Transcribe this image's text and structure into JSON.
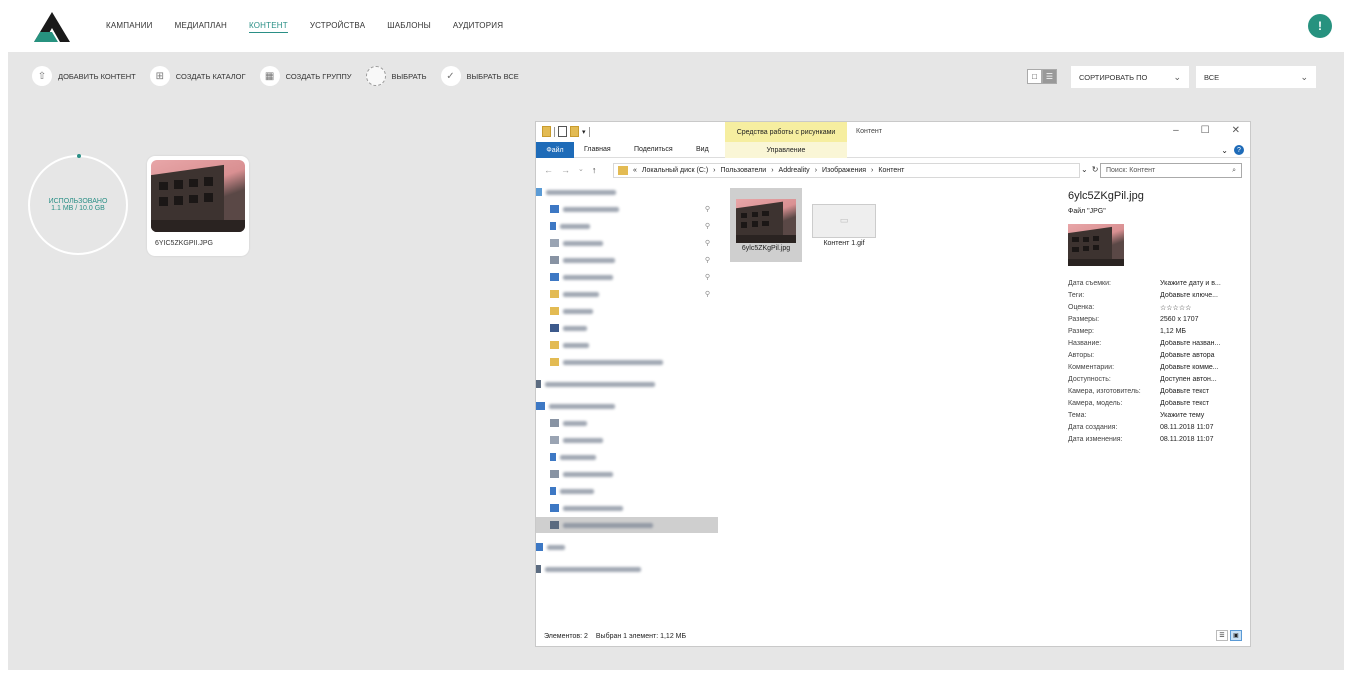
{
  "nav": {
    "items": [
      {
        "label": "КАМПАНИИ",
        "active": false
      },
      {
        "label": "МЕДИАПЛАН",
        "active": false
      },
      {
        "label": "КОНТЕНТ",
        "active": true
      },
      {
        "label": "УСТРОЙСТВА",
        "active": false
      },
      {
        "label": "ШАБЛОНЫ",
        "active": false
      },
      {
        "label": "АУДИТОРИЯ",
        "active": false
      }
    ]
  },
  "user": {
    "badge": "!"
  },
  "toolbar": {
    "add_content": "ДОБАВИТЬ КОНТЕНТ",
    "create_folder": "СОЗДАТЬ КАТАЛОГ",
    "create_group": "СОЗДАТЬ ГРУППУ",
    "select": "ВЫБРАТЬ",
    "select_all": "ВЫБРАТЬ ВСЕ",
    "sort_label": "СОРТИРОВАТЬ ПО",
    "filter_label": "ВСЕ"
  },
  "usage": {
    "label": "ИСПОЛЬЗОВАНО",
    "value": "1.1 MB / 10.0 GB"
  },
  "card": {
    "filename": "6YIC5ZKGPII.JPG"
  },
  "explorer": {
    "tools_tab": "Средства работы с рисунками",
    "window_title": "Контент",
    "ribbon": {
      "file": "Файл",
      "home": "Главная",
      "share": "Поделиться",
      "view": "Вид",
      "manage": "Управление"
    },
    "address": {
      "prefix": "«",
      "parts": [
        "Локальный диск (C:)",
        "Пользователи",
        "Addreality",
        "Изображения",
        "Контент"
      ],
      "separator": "›"
    },
    "search_placeholder": "Поиск: Контент",
    "files": [
      {
        "name": "6ylc5ZKgPil.jpg",
        "selected": true
      },
      {
        "name": "Контент 1.gif",
        "selected": false
      }
    ],
    "details": {
      "name": "6ylc5ZKgPil.jpg",
      "type": "Файл \"JPG\"",
      "props": [
        {
          "k": "Дата съемки:",
          "v": "Укажите дату и в..."
        },
        {
          "k": "Теги:",
          "v": "Добавьте ключе..."
        },
        {
          "k": "Оценка:",
          "v": "☆☆☆☆☆"
        },
        {
          "k": "Размеры:",
          "v": "2560 x 1707"
        },
        {
          "k": "Размер:",
          "v": "1,12 МБ"
        },
        {
          "k": "Название:",
          "v": "Добавьте назван..."
        },
        {
          "k": "Авторы:",
          "v": "Добавьте автора"
        },
        {
          "k": "Комментарии:",
          "v": "Добавьте комме..."
        },
        {
          "k": "Доступность:",
          "v": "Доступен автон..."
        },
        {
          "k": "Камера, изготовитель:",
          "v": "Добавьте текст"
        },
        {
          "k": "Камера, модель:",
          "v": "Добавьте текст"
        },
        {
          "k": "Тема:",
          "v": "Укажите тему"
        },
        {
          "k": "Дата создания:",
          "v": "08.11.2018 11:07"
        },
        {
          "k": "Дата изменения:",
          "v": "08.11.2018 11:07"
        }
      ]
    },
    "status": {
      "items_count": "Элементов: 2",
      "selected": "Выбран 1 элемент: 1,12 МБ"
    }
  }
}
